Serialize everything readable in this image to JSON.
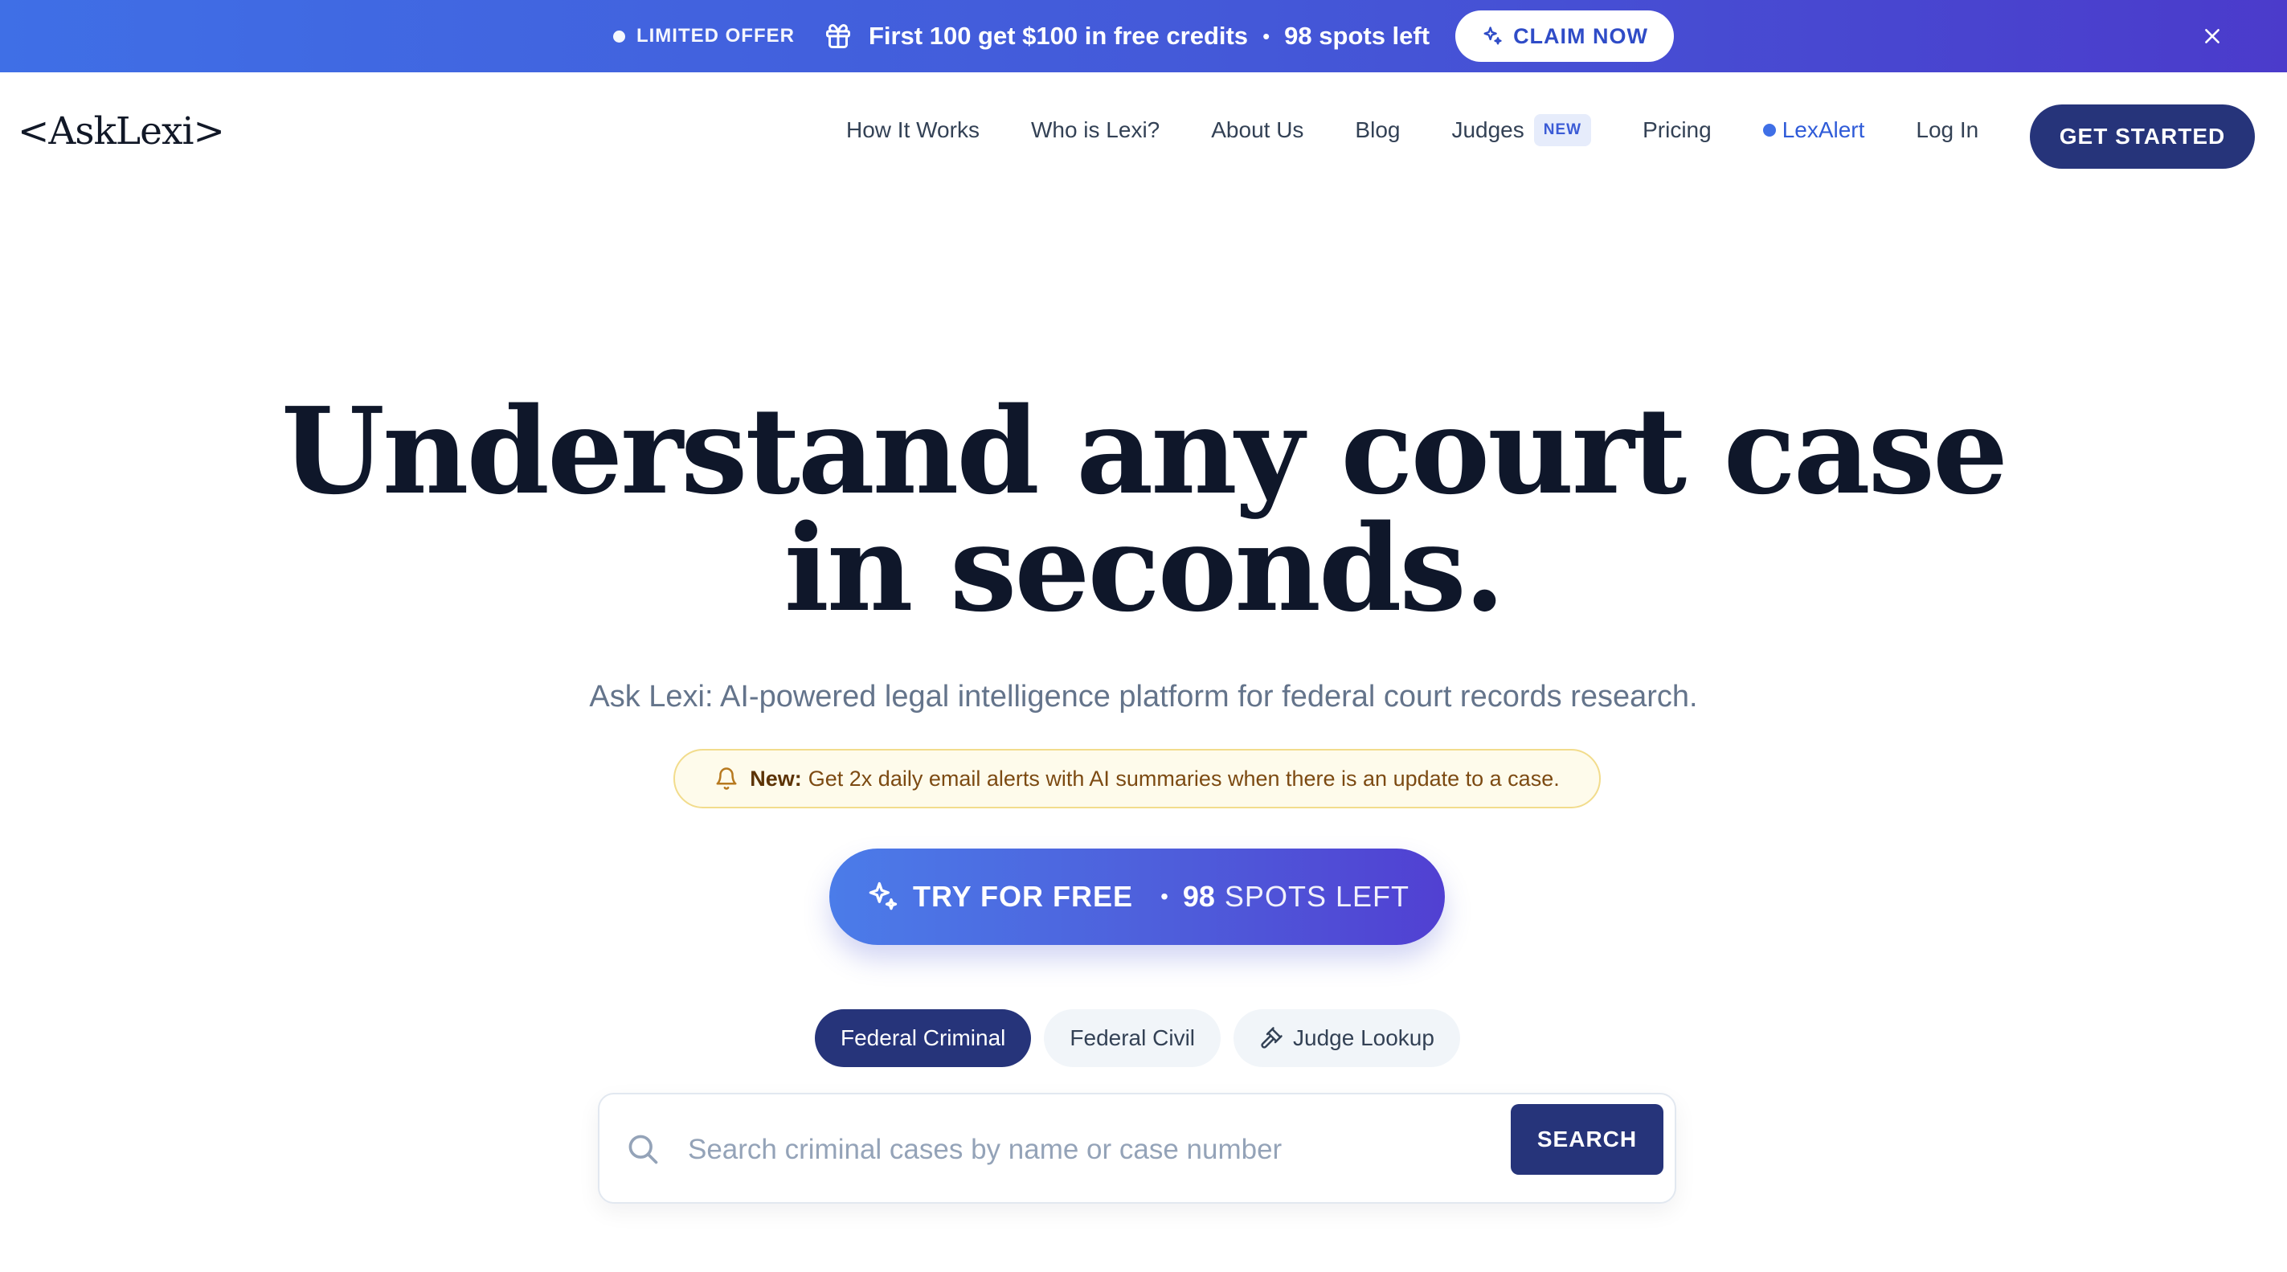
{
  "colors": {
    "banner_start": "#3f6fe6",
    "banner_end": "#4b3bcb",
    "primary_navy": "#26347a",
    "accent_blue": "#3f6fe6",
    "notice_bg": "#fefbeb",
    "notice_border": "#f2dc8c"
  },
  "promo": {
    "tag": "LIMITED OFFER",
    "icon": "gift-icon",
    "message": "First 100 get $100 in free credits",
    "separator": "•",
    "spots": "98 spots left",
    "claim_label": "CLAIM NOW",
    "claim_icon": "sparkle-icon",
    "close_icon": "close-icon"
  },
  "nav": {
    "logo": "<AskLexi>",
    "links": [
      {
        "label": "How It Works"
      },
      {
        "label": "Who is Lexi?"
      },
      {
        "label": "About Us"
      },
      {
        "label": "Blog"
      },
      {
        "label": "Judges",
        "badge": "NEW"
      },
      {
        "label": "Pricing"
      },
      {
        "label": "LexAlert"
      },
      {
        "label": "Log In"
      }
    ],
    "cta": "GET STARTED"
  },
  "hero": {
    "title_line1": "Understand any court case",
    "title_line2": "in seconds.",
    "subtitle": "Ask Lexi: AI-powered legal intelligence platform for federal court records research.",
    "notice_icon": "bell-icon",
    "notice_bold": "New:",
    "notice_text": "Get 2x daily email alerts with AI summaries when there is an update to a case.",
    "try_icon": "sparkle-icon",
    "try_label": "TRY FOR FREE",
    "try_dot": "•",
    "try_spots_number": "98",
    "try_spots_word": "SPOTS LEFT"
  },
  "search": {
    "tabs": [
      {
        "label": "Federal Criminal",
        "active": true
      },
      {
        "label": "Federal Civil",
        "active": false
      },
      {
        "label": "Judge Lookup",
        "active": false,
        "icon": "gavel-icon"
      }
    ],
    "placeholder": "Search criminal cases by name or case number...",
    "value": "",
    "button": "SEARCH",
    "icon": "search-icon"
  }
}
